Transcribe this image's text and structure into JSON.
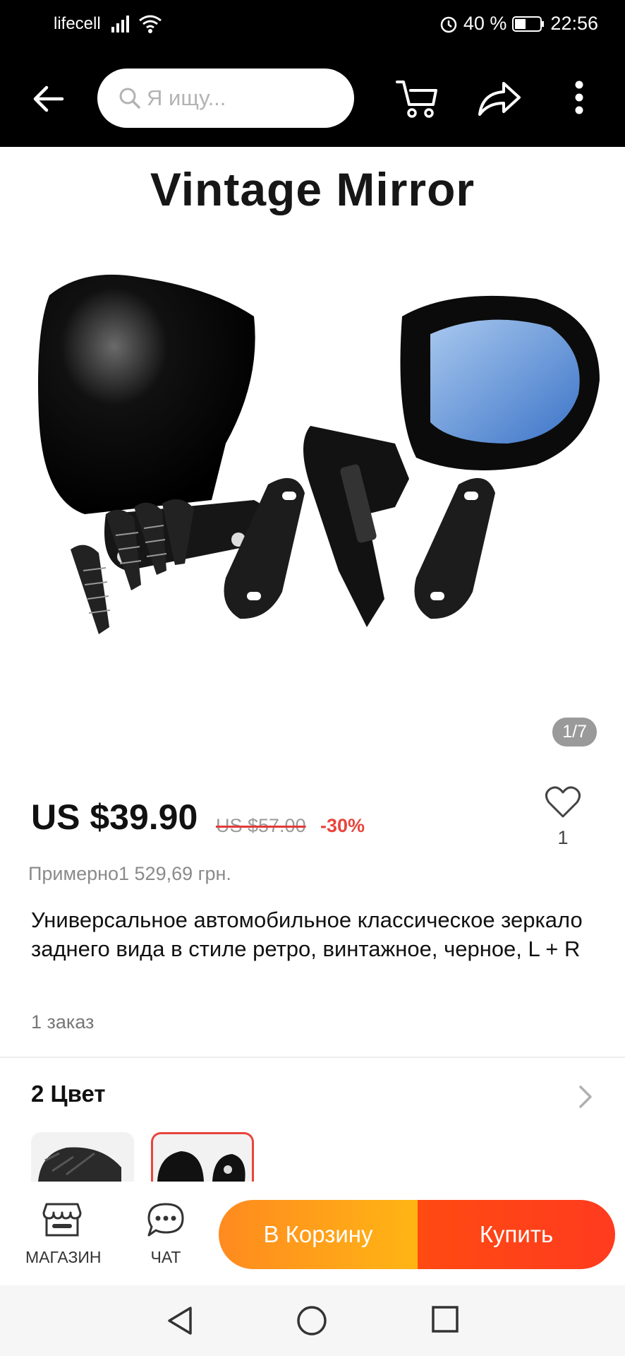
{
  "status_bar": {
    "carrier": "lifecell",
    "battery": "40 %",
    "time": "22:56"
  },
  "header": {
    "search_placeholder": "Я ищу..."
  },
  "gallery": {
    "image_title": "Vintage Mirror",
    "counter": "1/7"
  },
  "product": {
    "price": "US $39.90",
    "old_price": "US $57.00",
    "discount": "-30%",
    "wishlist_count": "1",
    "approx_price": "Примерно1 529,69 грн.",
    "title": "Универсальное автомобильное классическое зеркало заднего вида в стиле ретро, винтажное, черное, L + R",
    "orders": "1 заказ"
  },
  "variants": {
    "label": "2 Цвет"
  },
  "actions": {
    "store_label": "МАГАЗИН",
    "chat_label": "ЧАТ",
    "cart_button": "В Корзину",
    "buy_button": "Купить"
  },
  "colors": {
    "accent_orange": "#ffa01a",
    "accent_red": "#ff3b1f",
    "discount_red": "#e8453c"
  }
}
